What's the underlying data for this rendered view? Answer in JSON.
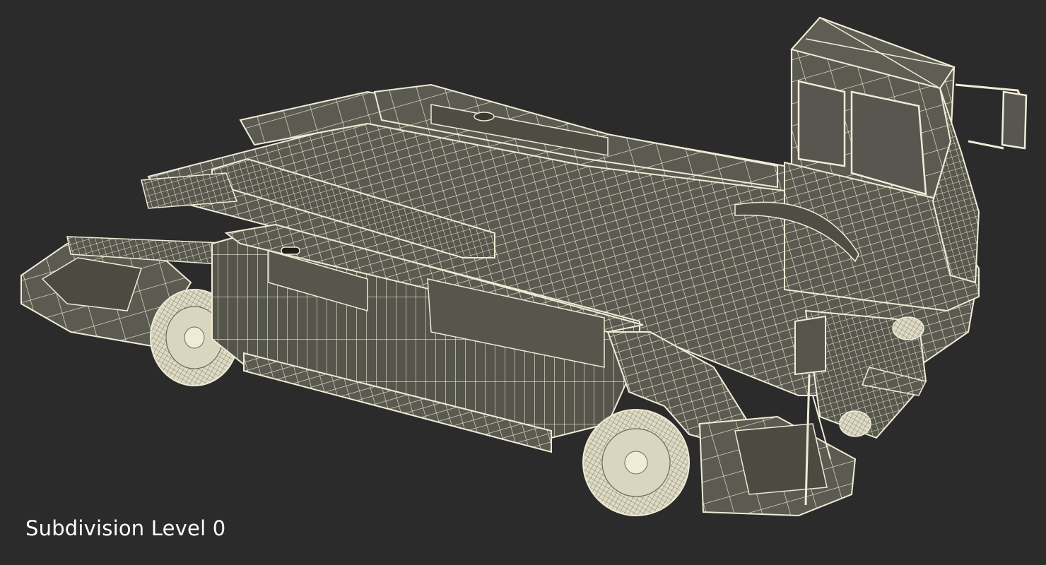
{
  "caption": {
    "text": "Subdivision Level 0"
  },
  "colors": {
    "background": "#2b2b2b",
    "surface": "#57574d",
    "surface_dark": "#45453d",
    "wire": "#efebd6",
    "caption_text": "#ffffff"
  }
}
